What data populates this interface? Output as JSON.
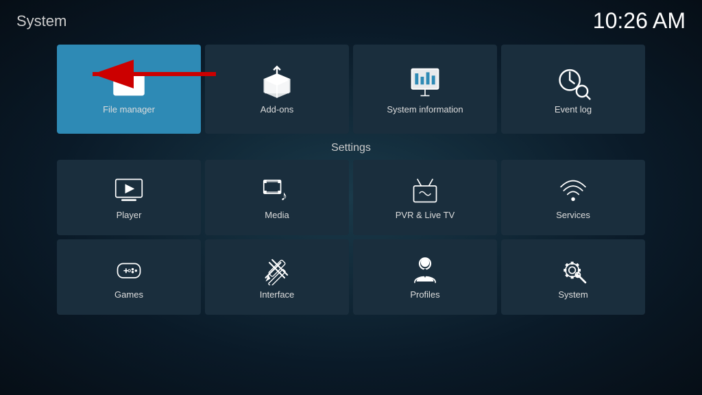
{
  "header": {
    "title": "System",
    "time": "10:26 AM"
  },
  "top_row": [
    {
      "id": "file-manager",
      "label": "File manager",
      "active": true
    },
    {
      "id": "add-ons",
      "label": "Add-ons",
      "active": false
    },
    {
      "id": "system-information",
      "label": "System information",
      "active": false
    },
    {
      "id": "event-log",
      "label": "Event log",
      "active": false
    }
  ],
  "settings_label": "Settings",
  "settings_row1": [
    {
      "id": "player",
      "label": "Player"
    },
    {
      "id": "media",
      "label": "Media"
    },
    {
      "id": "pvr-live-tv",
      "label": "PVR & Live TV"
    },
    {
      "id": "services",
      "label": "Services"
    }
  ],
  "settings_row2": [
    {
      "id": "games",
      "label": "Games"
    },
    {
      "id": "interface",
      "label": "Interface"
    },
    {
      "id": "profiles",
      "label": "Profiles"
    },
    {
      "id": "system",
      "label": "System"
    }
  ]
}
